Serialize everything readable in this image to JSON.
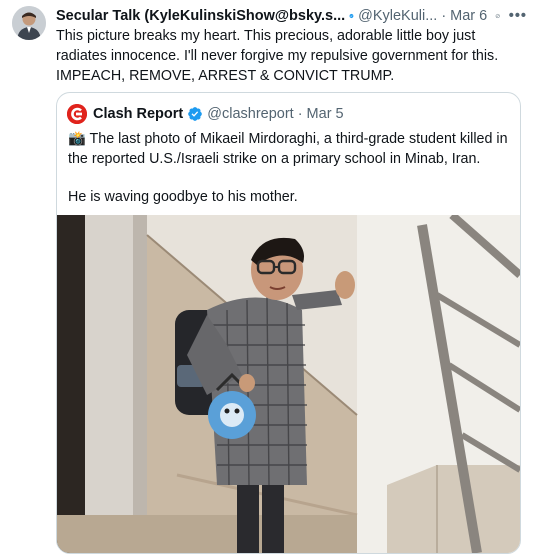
{
  "post": {
    "display_name": "Secular Talk (KyleKulinskiShow@bsky.s...",
    "handle": "@KyleKuli...",
    "separator": "·",
    "date": "Mar 6",
    "more_icon": "more-icon",
    "body": "This picture breaks my heart. This precious, adorable little boy just radiates innocence. I'll never forgive my repulsive government for this. IMPEACH, REMOVE, ARREST & CONVICT TRUMP."
  },
  "quote": {
    "display_name": "Clash Report",
    "handle": "@clashreport",
    "separator": "·",
    "date": "Mar 5",
    "body_line1": "📸 The last photo of Mikaeil Mirdoraghi, a third-grade student killed in the reported U.S./Israeli strike on a primary school in Minab, Iran.",
    "body_line2": "He is waving goodbye to his mother."
  },
  "colors": {
    "verified": "#1d9bf0",
    "secondary_text": "#536471",
    "border": "#cfd9de",
    "clash_logo": "#e0231c"
  },
  "icons": [
    "verified-badge-icon",
    "grok-icon",
    "more-icon",
    "clash-report-logo-icon",
    "camera-emoji-icon"
  ]
}
